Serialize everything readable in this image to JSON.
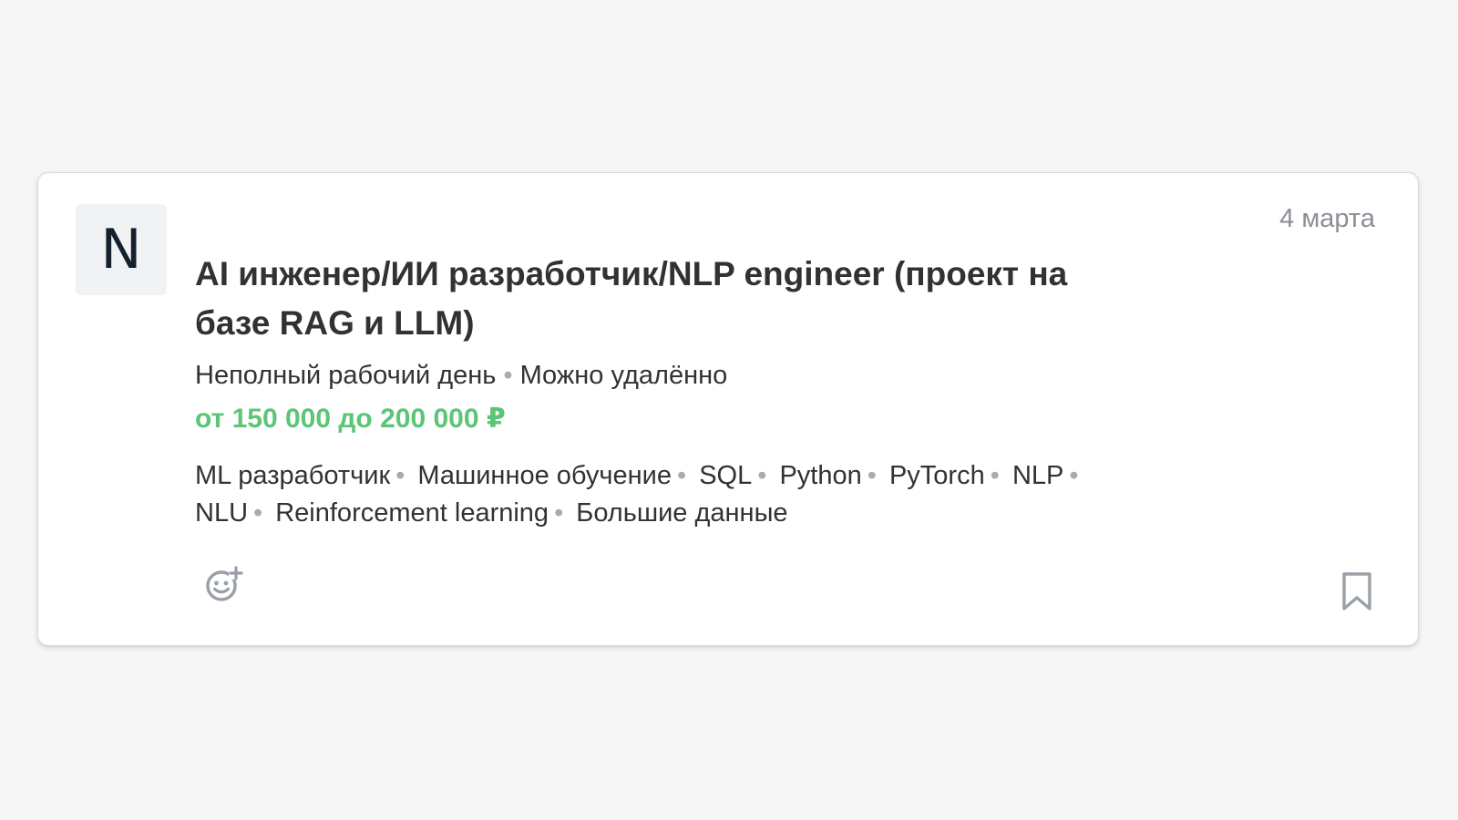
{
  "vacancy": {
    "logo_letter": "N",
    "date": "4 марта",
    "title": "AI инженер/ИИ разработчик/NLP engineer (проект на базе RAG и LLM)",
    "schedule": "Неполный рабочий день",
    "remote": "Можно удалённо",
    "separator": "•",
    "salary": "от 150 000 до 200 000 ₽",
    "skills": [
      "ML разработчик",
      "Машинное обучение",
      "SQL",
      "Python",
      "PyTorch",
      "NLP",
      "NLU",
      "Reinforcement learning",
      "Большие данные"
    ],
    "react_icon": "emoji-add-icon",
    "bookmark_icon": "bookmark-icon"
  },
  "colors": {
    "salary": "#5cc576",
    "text": "#303233",
    "muted": "#8a8f96"
  }
}
